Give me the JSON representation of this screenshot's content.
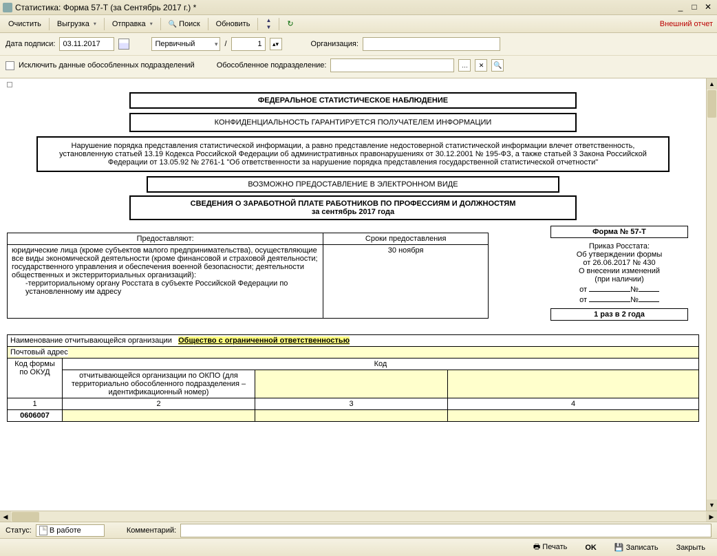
{
  "window": {
    "title": "Статистика: Форма 57-Т (за Сентябрь 2017 г.) *"
  },
  "toolbar": {
    "clear": "Очистить",
    "export": "Выгрузка",
    "send": "Отправка",
    "search": "Поиск",
    "refresh": "Обновить",
    "external": "Внешний отчет"
  },
  "filters": {
    "sign_date_label": "Дата подписи:",
    "sign_date": "03.11.2017",
    "type": "Первичный",
    "slash": "/",
    "num": "1",
    "org_label": "Организация:",
    "exclude_label": "Исключить данные обособленных подразделений",
    "dept_label": "Обособленное подразделение:"
  },
  "doc": {
    "h1": "ФЕДЕРАЛЬНОЕ СТАТИСТИЧЕСКОЕ НАБЛЮДЕНИЕ",
    "h2": "КОНФИДЕНЦИАЛЬНОСТЬ ГАРАНТИРУЕТСЯ ПОЛУЧАТЕЛЕМ ИНФОРМАЦИИ",
    "warn": "Нарушение порядка представления статистической информации, а равно представление недостоверной статистической информации влечет ответственность, установленную статьей 13.19 Кодекса Российской Федерации об административных правонарушениях от 30.12.2001 № 195-ФЗ, а также статьей 3 Закона Российской Федерации от 13.05.92 № 2761-1 \"Об ответственности за нарушение порядка представления государственной статистической отчетности\"",
    "electronic": "ВОЗМОЖНО ПРЕДОСТАВЛЕНИЕ В ЭЛЕКТРОННОМ ВИДЕ",
    "title1": "СВЕДЕНИЯ О ЗАРАБОТНОЙ ПЛАТЕ РАБОТНИКОВ ПО ПРОФЕССИЯМ И ДОЛЖНОСТЯМ",
    "title2": "за сентябрь 2017 года",
    "provide_hdr": "Предоставляют:",
    "deadline_hdr": "Сроки предоставления",
    "provide_body": "юридические лица (кроме субъектов малого предпринимательства), осуществляющие все виды экономической деятельности (кроме финансовой и страховой деятельности; государственного управления и обеспечения военной безопасности; деятельности общественных и экстерриториальных организаций):",
    "provide_sub": "-территориальному органу Росстата в субъекте Российской Федерации по установленному им адресу",
    "deadline": "30 ноября",
    "formno_hdr": "Форма № 57-Т",
    "order1": "Приказ Росстата:",
    "order2": "Об утверждении формы",
    "order3": "от 26.06.2017 № 430",
    "order4": "О внесении изменений",
    "order5": "(при наличии)",
    "ot": "от",
    "no": "№",
    "freq": "1 раз в 2 года",
    "org_row_label": "Наименование отчитывающейся организации",
    "org_name": "Общество с ограниченной ответственностью",
    "addr_label": "Почтовый адрес",
    "code_hdr": "Код",
    "okud_label": "Код формы по ОКУД",
    "okpo_label": "отчитывающейся организации по ОКПО (для территориально обособленного подразделения – идентификационный номер)",
    "c1": "1",
    "c2": "2",
    "c3": "3",
    "c4": "4",
    "okud": "0606007"
  },
  "status": {
    "label": "Статус:",
    "value": "В работе",
    "comment_label": "Комментарий:"
  },
  "bottom": {
    "print": "Печать",
    "ok": "OK",
    "save": "Записать",
    "close": "Закрыть"
  }
}
